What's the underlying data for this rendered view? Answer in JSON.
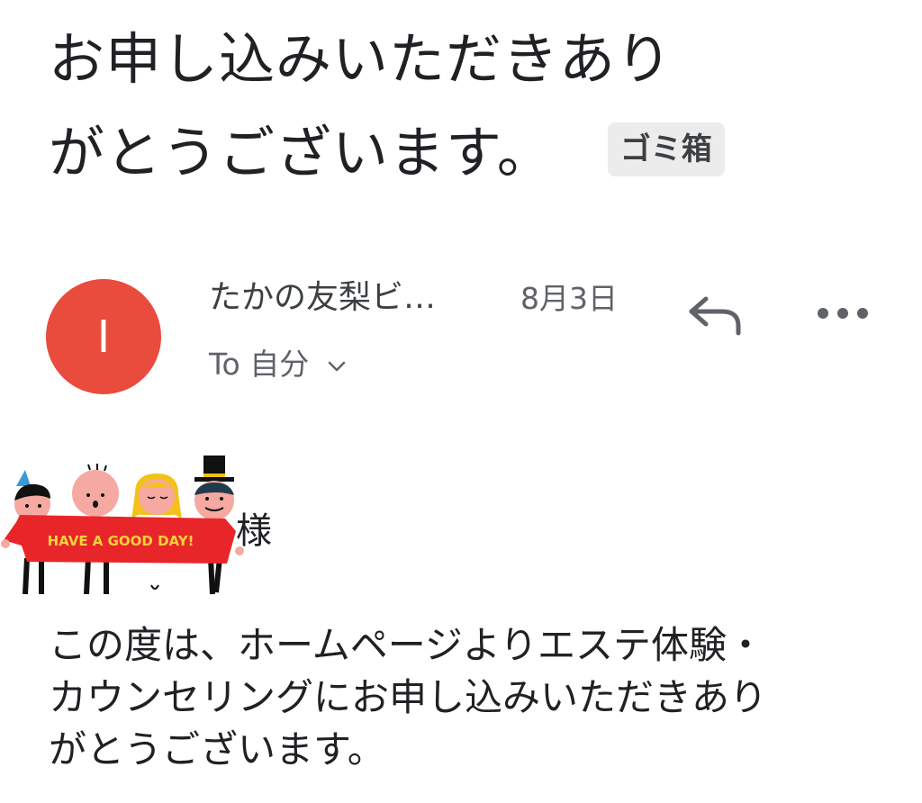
{
  "email": {
    "subject_line1": "お申し込みいただきあり",
    "subject_line2": "がとうございます。",
    "label": "ゴミ箱",
    "sender_initial": "I",
    "sender_name": "たかの友梨ビ…",
    "date": "8月3日",
    "recipient": "To 自分",
    "greeting_suffix": "様",
    "greeting_image_text": "HAVE A GOOD DAY!",
    "body_line1": "この度は、ホームページよりエステ体験・",
    "body_line2": "カウンセリングにお申し込みいただきあり",
    "body_line3": "がとうございます。"
  },
  "colors": {
    "avatar": "#e94b3c",
    "chip_bg": "#ececec",
    "banner": "#e8262a"
  },
  "icons": {
    "reply": "reply-icon",
    "more": "more-options-icon",
    "expand": "chevron-down-icon"
  }
}
